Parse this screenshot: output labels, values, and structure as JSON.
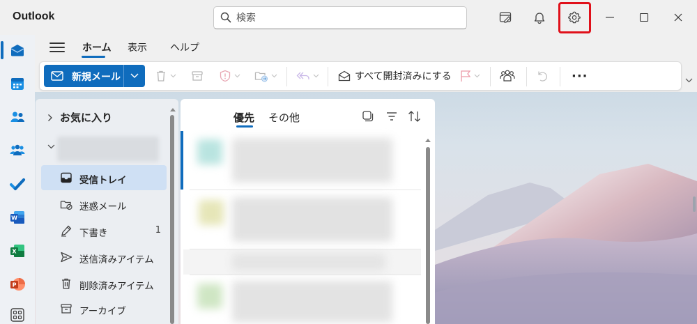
{
  "window": {
    "title": "Outlook",
    "controls": {
      "minimize": "minimize",
      "maximize": "maximize",
      "close": "close"
    }
  },
  "search": {
    "placeholder": "検索"
  },
  "titlebar_icons": [
    "my-day-icon",
    "bell-icon",
    "gear-icon"
  ],
  "highlight_color": "#e0101a",
  "accent_color": "#0f6cbd",
  "apprail": [
    "mail-icon",
    "calendar-icon",
    "people-icon",
    "groups-icon",
    "todo-icon",
    "word-icon",
    "excel-icon",
    "powerpoint-icon",
    "apps-icon"
  ],
  "ribbon": {
    "tabs": [
      {
        "label": "ホーム",
        "active": true
      },
      {
        "label": "表示",
        "active": false
      },
      {
        "label": "ヘルプ",
        "active": false
      }
    ],
    "new_mail_label": "新規メール",
    "mark_all_read_label": "すべて開封済みにする",
    "more_label": "···"
  },
  "folders": {
    "favorites_label": "お気に入り",
    "items": [
      {
        "label": "受信トレイ",
        "count": "",
        "icon": "inbox-icon",
        "selected": true
      },
      {
        "label": "迷惑メール",
        "count": "",
        "icon": "junk-icon",
        "selected": false
      },
      {
        "label": "下書き",
        "count": "1",
        "icon": "draft-icon",
        "selected": false
      },
      {
        "label": "送信済みアイテム",
        "count": "",
        "icon": "sent-icon",
        "selected": false
      },
      {
        "label": "削除済みアイテム",
        "count": "",
        "icon": "trash-icon",
        "selected": false
      },
      {
        "label": "アーカイブ",
        "count": "",
        "icon": "archive-icon",
        "selected": false
      }
    ]
  },
  "message_list": {
    "tabs": [
      {
        "label": "優先",
        "active": true
      },
      {
        "label": "その他",
        "active": false
      }
    ]
  }
}
